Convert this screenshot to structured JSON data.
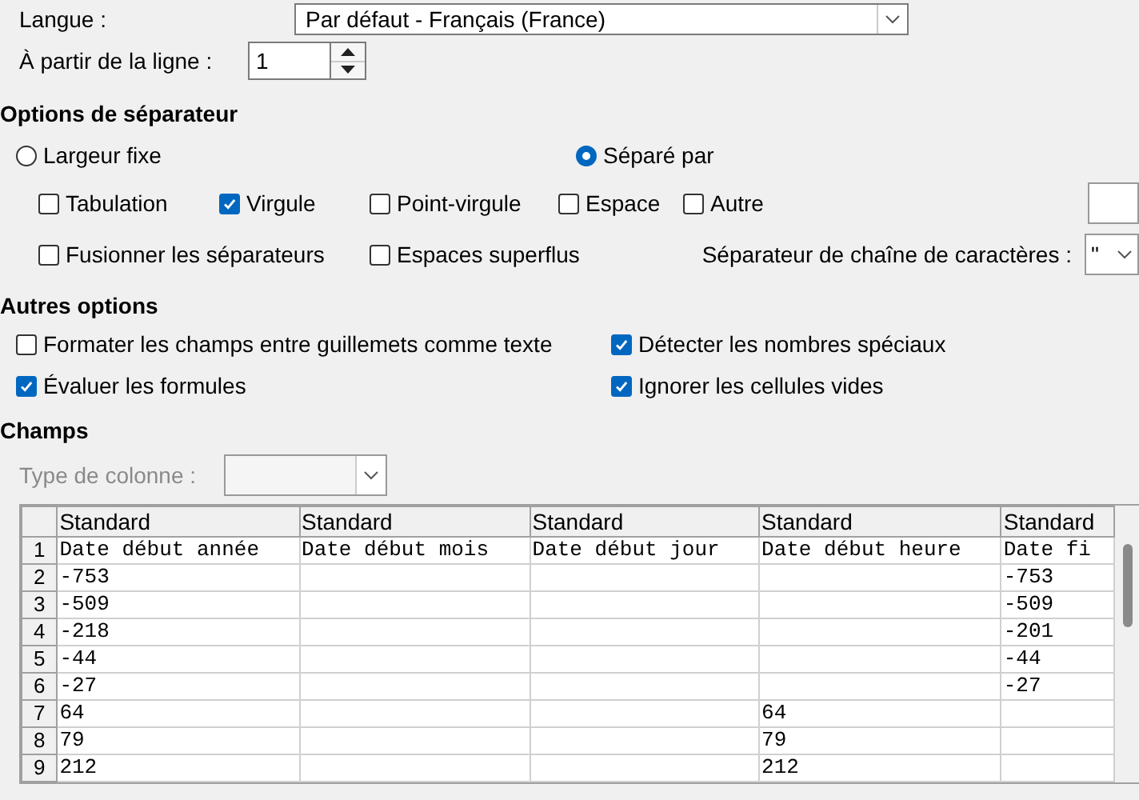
{
  "language": {
    "label": "Langue :",
    "value": "Par défaut - Français (France)"
  },
  "start_row": {
    "label": "À partir de la ligne :",
    "value": "1"
  },
  "separator_options": {
    "title": "Options de séparateur",
    "modes": [
      {
        "label": "Largeur fixe",
        "selected": false
      },
      {
        "label": "Séparé par",
        "selected": true
      }
    ],
    "separators": [
      {
        "label": "Tabulation",
        "checked": false
      },
      {
        "label": "Virgule",
        "checked": true
      },
      {
        "label": "Point-virgule",
        "checked": false
      },
      {
        "label": "Espace",
        "checked": false
      },
      {
        "label": "Autre",
        "checked": false
      }
    ],
    "flags": [
      {
        "label": "Fusionner les séparateurs",
        "checked": false
      },
      {
        "label": "Espaces superflus",
        "checked": false
      }
    ],
    "string_delimiter": {
      "label": "Séparateur de chaîne de caractères :",
      "value": "\""
    }
  },
  "other_options": {
    "title": "Autres options",
    "items": [
      {
        "label": "Formater les champs entre guillemets comme texte",
        "checked": false
      },
      {
        "label": "Détecter les nombres spéciaux",
        "checked": true
      },
      {
        "label": "Évaluer les formules",
        "checked": true
      },
      {
        "label": "Ignorer les cellules vides",
        "checked": true
      }
    ]
  },
  "fields": {
    "title": "Champs",
    "column_type": {
      "label": "Type de colonne :",
      "disabled": true
    },
    "table": {
      "columns": [
        "Standard",
        "Standard",
        "Standard",
        "Standard",
        "Standard"
      ],
      "rows": [
        {
          "number": "1",
          "cells": [
            "Date début année",
            "Date début mois",
            "Date début jour",
            "Date début heure",
            "Date fi"
          ]
        },
        {
          "number": "2",
          "cells": [
            "-753",
            null,
            null,
            null,
            "-753"
          ]
        },
        {
          "number": "3",
          "cells": [
            "-509",
            null,
            null,
            null,
            "-509"
          ]
        },
        {
          "number": "4",
          "cells": [
            "-218",
            null,
            null,
            null,
            "-201"
          ]
        },
        {
          "number": "5",
          "cells": [
            "-44",
            null,
            null,
            null,
            "-44"
          ]
        },
        {
          "number": "6",
          "cells": [
            "-27",
            null,
            null,
            null,
            "-27"
          ]
        },
        {
          "number": "7",
          "cells": [
            "64",
            null,
            null,
            "64",
            null
          ]
        },
        {
          "number": "8",
          "cells": [
            "79",
            null,
            null,
            "79",
            null
          ]
        },
        {
          "number": "9",
          "cells": [
            "212",
            null,
            null,
            "212",
            null
          ]
        }
      ]
    }
  }
}
